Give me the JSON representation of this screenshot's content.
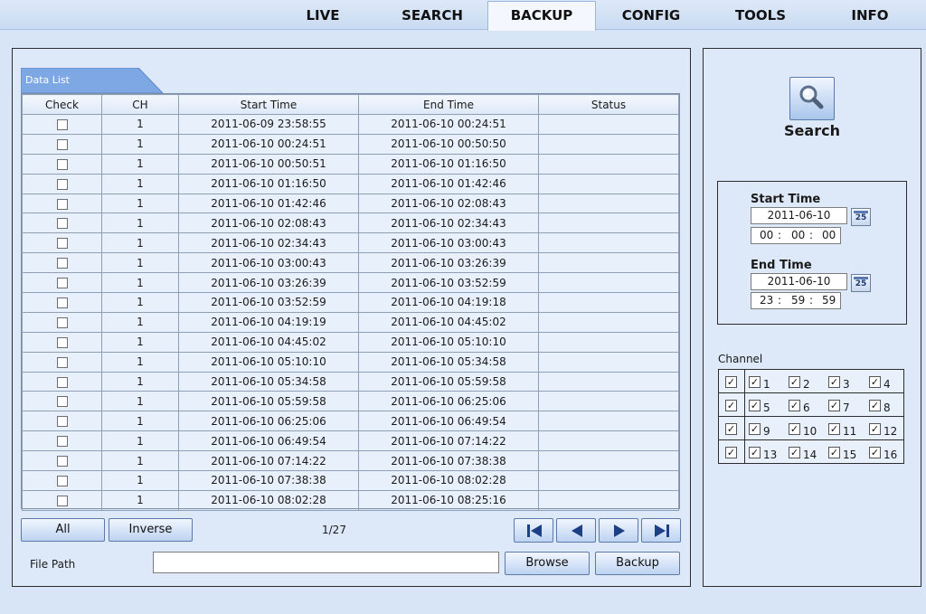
{
  "top_tabs": [
    "LIVE",
    "SEARCH",
    "BACKUP",
    "CONFIG",
    "TOOLS",
    "INFO"
  ],
  "active_tab": "BACKUP",
  "data_list": {
    "tag_label": "Data List",
    "headers": {
      "check": "Check",
      "ch": "CH",
      "start": "Start Time",
      "end": "End Time",
      "status": "Status"
    },
    "rows": [
      {
        "ch": "1",
        "start": "2011-06-09 23:58:55",
        "end": "2011-06-10 00:24:51",
        "status": ""
      },
      {
        "ch": "1",
        "start": "2011-06-10 00:24:51",
        "end": "2011-06-10 00:50:50",
        "status": ""
      },
      {
        "ch": "1",
        "start": "2011-06-10 00:50:51",
        "end": "2011-06-10 01:16:50",
        "status": ""
      },
      {
        "ch": "1",
        "start": "2011-06-10 01:16:50",
        "end": "2011-06-10 01:42:46",
        "status": ""
      },
      {
        "ch": "1",
        "start": "2011-06-10 01:42:46",
        "end": "2011-06-10 02:08:43",
        "status": ""
      },
      {
        "ch": "1",
        "start": "2011-06-10 02:08:43",
        "end": "2011-06-10 02:34:43",
        "status": ""
      },
      {
        "ch": "1",
        "start": "2011-06-10 02:34:43",
        "end": "2011-06-10 03:00:43",
        "status": ""
      },
      {
        "ch": "1",
        "start": "2011-06-10 03:00:43",
        "end": "2011-06-10 03:26:39",
        "status": ""
      },
      {
        "ch": "1",
        "start": "2011-06-10 03:26:39",
        "end": "2011-06-10 03:52:59",
        "status": ""
      },
      {
        "ch": "1",
        "start": "2011-06-10 03:52:59",
        "end": "2011-06-10 04:19:18",
        "status": ""
      },
      {
        "ch": "1",
        "start": "2011-06-10 04:19:19",
        "end": "2011-06-10 04:45:02",
        "status": ""
      },
      {
        "ch": "1",
        "start": "2011-06-10 04:45:02",
        "end": "2011-06-10 05:10:10",
        "status": ""
      },
      {
        "ch": "1",
        "start": "2011-06-10 05:10:10",
        "end": "2011-06-10 05:34:58",
        "status": ""
      },
      {
        "ch": "1",
        "start": "2011-06-10 05:34:58",
        "end": "2011-06-10 05:59:58",
        "status": ""
      },
      {
        "ch": "1",
        "start": "2011-06-10 05:59:58",
        "end": "2011-06-10 06:25:06",
        "status": ""
      },
      {
        "ch": "1",
        "start": "2011-06-10 06:25:06",
        "end": "2011-06-10 06:49:54",
        "status": ""
      },
      {
        "ch": "1",
        "start": "2011-06-10 06:49:54",
        "end": "2011-06-10 07:14:22",
        "status": ""
      },
      {
        "ch": "1",
        "start": "2011-06-10 07:14:22",
        "end": "2011-06-10 07:38:38",
        "status": ""
      },
      {
        "ch": "1",
        "start": "2011-06-10 07:38:38",
        "end": "2011-06-10 08:02:28",
        "status": ""
      },
      {
        "ch": "1",
        "start": "2011-06-10 08:02:28",
        "end": "2011-06-10 08:25:16",
        "status": ""
      }
    ]
  },
  "controls": {
    "all_label": "All",
    "inverse_label": "Inverse",
    "page_indicator": "1/27",
    "nav_icons": [
      "first-page-icon",
      "prev-page-icon",
      "next-page-icon",
      "last-page-icon"
    ],
    "file_path_label": "File Path",
    "file_path_value": "",
    "browse_label": "Browse",
    "backup_label": "Backup"
  },
  "search_panel": {
    "search_label": "Search",
    "search_icon": "magnifier-icon",
    "start_time_label": "Start Time",
    "start_date": "2011-06-10",
    "start_hh": "00",
    "start_mm": "00",
    "start_ss": "00",
    "end_time_label": "End Time",
    "end_date": "2011-06-10",
    "end_hh": "23",
    "end_mm": "59",
    "end_ss": "59",
    "calendar_icon_text": "25",
    "time_separator": ":",
    "channel_label": "Channel",
    "channels": [
      {
        "num": "1",
        "checked": true
      },
      {
        "num": "2",
        "checked": true
      },
      {
        "num": "3",
        "checked": true
      },
      {
        "num": "4",
        "checked": true
      },
      {
        "num": "5",
        "checked": true
      },
      {
        "num": "6",
        "checked": true
      },
      {
        "num": "7",
        "checked": true
      },
      {
        "num": "8",
        "checked": true
      },
      {
        "num": "9",
        "checked": true
      },
      {
        "num": "10",
        "checked": true
      },
      {
        "num": "11",
        "checked": true
      },
      {
        "num": "12",
        "checked": true
      },
      {
        "num": "13",
        "checked": true
      },
      {
        "num": "14",
        "checked": true
      },
      {
        "num": "15",
        "checked": true
      },
      {
        "num": "16",
        "checked": true
      }
    ],
    "check_mark": "✓"
  }
}
